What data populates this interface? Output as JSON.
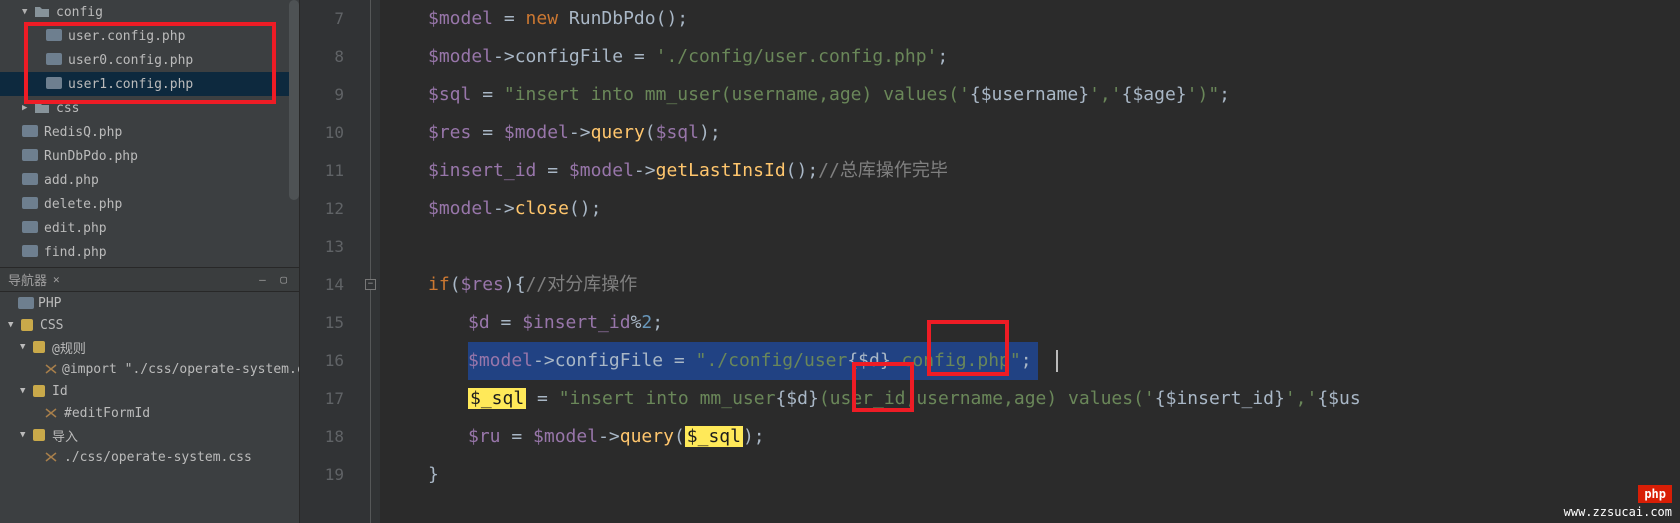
{
  "tree": {
    "root": {
      "label": "config"
    },
    "items": [
      {
        "label": "user.config.php"
      },
      {
        "label": "user0.config.php"
      },
      {
        "label": "user1.config.php"
      },
      {
        "label": "css"
      },
      {
        "label": "RedisQ.php"
      },
      {
        "label": "RunDbPdo.php"
      },
      {
        "label": "add.php"
      },
      {
        "label": "delete.php"
      },
      {
        "label": "edit.php"
      },
      {
        "label": "find.php"
      }
    ]
  },
  "navigator": {
    "title": "导航器",
    "php_label": "PHP",
    "css_label": "CSS",
    "rule_label": "@规则",
    "import_label": "@import \"./css/operate-system.css",
    "id_label": "Id",
    "editform_label": "#editFormId",
    "import2_label": "导入",
    "opsys_label": "./css/operate-system.css"
  },
  "code": {
    "l7": {
      "var": "$model",
      "eq": " = ",
      "kw": "new",
      "sp": " ",
      "cls": "RunDbPdo",
      "rest": "();"
    },
    "l8": {
      "var": "$model",
      "arrow": "->",
      "prop": "configFile",
      "eq": " = ",
      "str": "'./config/user.config.php'",
      "semi": ";"
    },
    "l9": {
      "var": "$sql",
      "eq": " = ",
      "str1": "\"insert into mm_user(username,age) values('",
      "int1": "{$username}",
      "str2": "','",
      "int2": "{$age}",
      "str3": "')\"",
      "semi": ";"
    },
    "l10": {
      "var1": "$res",
      "eq": " = ",
      "var2": "$model",
      "arrow": "->",
      "fn": "query",
      "open": "(",
      "arg": "$sql",
      "close": ");"
    },
    "l11": {
      "var1": "$insert_id",
      "eq": " = ",
      "var2": "$model",
      "arrow": "->",
      "fn": "getLastInsId",
      "rest": "();",
      "cmt": "//总库操作完毕"
    },
    "l12": {
      "var": "$model",
      "arrow": "->",
      "fn": "close",
      "rest": "();"
    },
    "l13": {
      "blank": ""
    },
    "l14": {
      "kw": "if",
      "open": "(",
      "var": "$res",
      "close": "){",
      "cmt": "//对分库操作"
    },
    "l15": {
      "var1": "$d",
      "eq": " = ",
      "var2": "$insert_id",
      "op": "%",
      "num": "2",
      "semi": ";"
    },
    "l16": {
      "var": "$model",
      "arrow": "->",
      "prop": "configFile",
      "eq": " = ",
      "str1": "\"./config/user",
      "int": "{$d}",
      "str2": ".config.php\"",
      "semi": ";"
    },
    "l17": {
      "mark": "$_sql",
      "eq": " = ",
      "str1": "\"insert into mm_user",
      "int1": "{$d}",
      "str2": "(user_id,username,age) values('",
      "int2": "{$insert_id}",
      "str3": "','",
      "int3": "{$us"
    },
    "l18": {
      "var1": "$ru",
      "eq": " = ",
      "var2": "$model",
      "arrow": "->",
      "fn": "query",
      "open": "(",
      "mark": "$_sql",
      "close": ");"
    },
    "l19": {
      "brace": "}"
    }
  },
  "gutter": [
    "7",
    "8",
    "9",
    "10",
    "11",
    "12",
    "13",
    "14",
    "15",
    "16",
    "17",
    "18",
    "19"
  ],
  "watermark": {
    "badge": "php",
    "url": "www.zzsucai.com"
  }
}
